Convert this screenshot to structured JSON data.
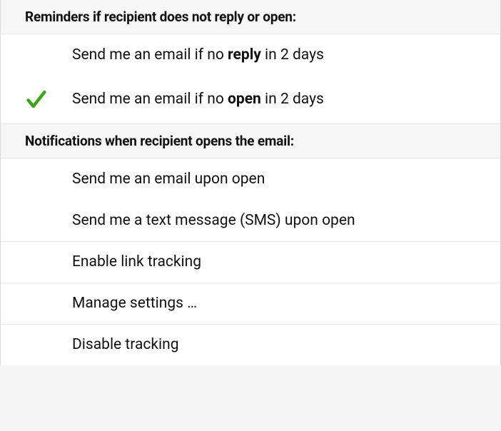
{
  "colors": {
    "check": "#3fa516"
  },
  "sections": {
    "reminders": {
      "header": "Reminders if recipient does not reply or open:",
      "items": {
        "no_reply": {
          "pre": "Send me an email if no ",
          "bold": "reply",
          "post": " in 2 days",
          "checked": false
        },
        "no_open": {
          "pre": "Send me an email if no ",
          "bold": "open",
          "post": " in 2 days",
          "checked": true
        }
      }
    },
    "open_notifications": {
      "header": "Notifications when recipient opens the email:",
      "items": {
        "email_on_open": {
          "label": "Send me an email upon open",
          "checked": false
        },
        "sms_on_open": {
          "label": "Send me a text message (SMS) upon open",
          "checked": false
        }
      }
    },
    "actions": {
      "enable_link_tracking": {
        "label": "Enable link tracking"
      },
      "manage_settings": {
        "label": "Manage settings …"
      },
      "disable_tracking": {
        "label": "Disable tracking"
      }
    }
  }
}
